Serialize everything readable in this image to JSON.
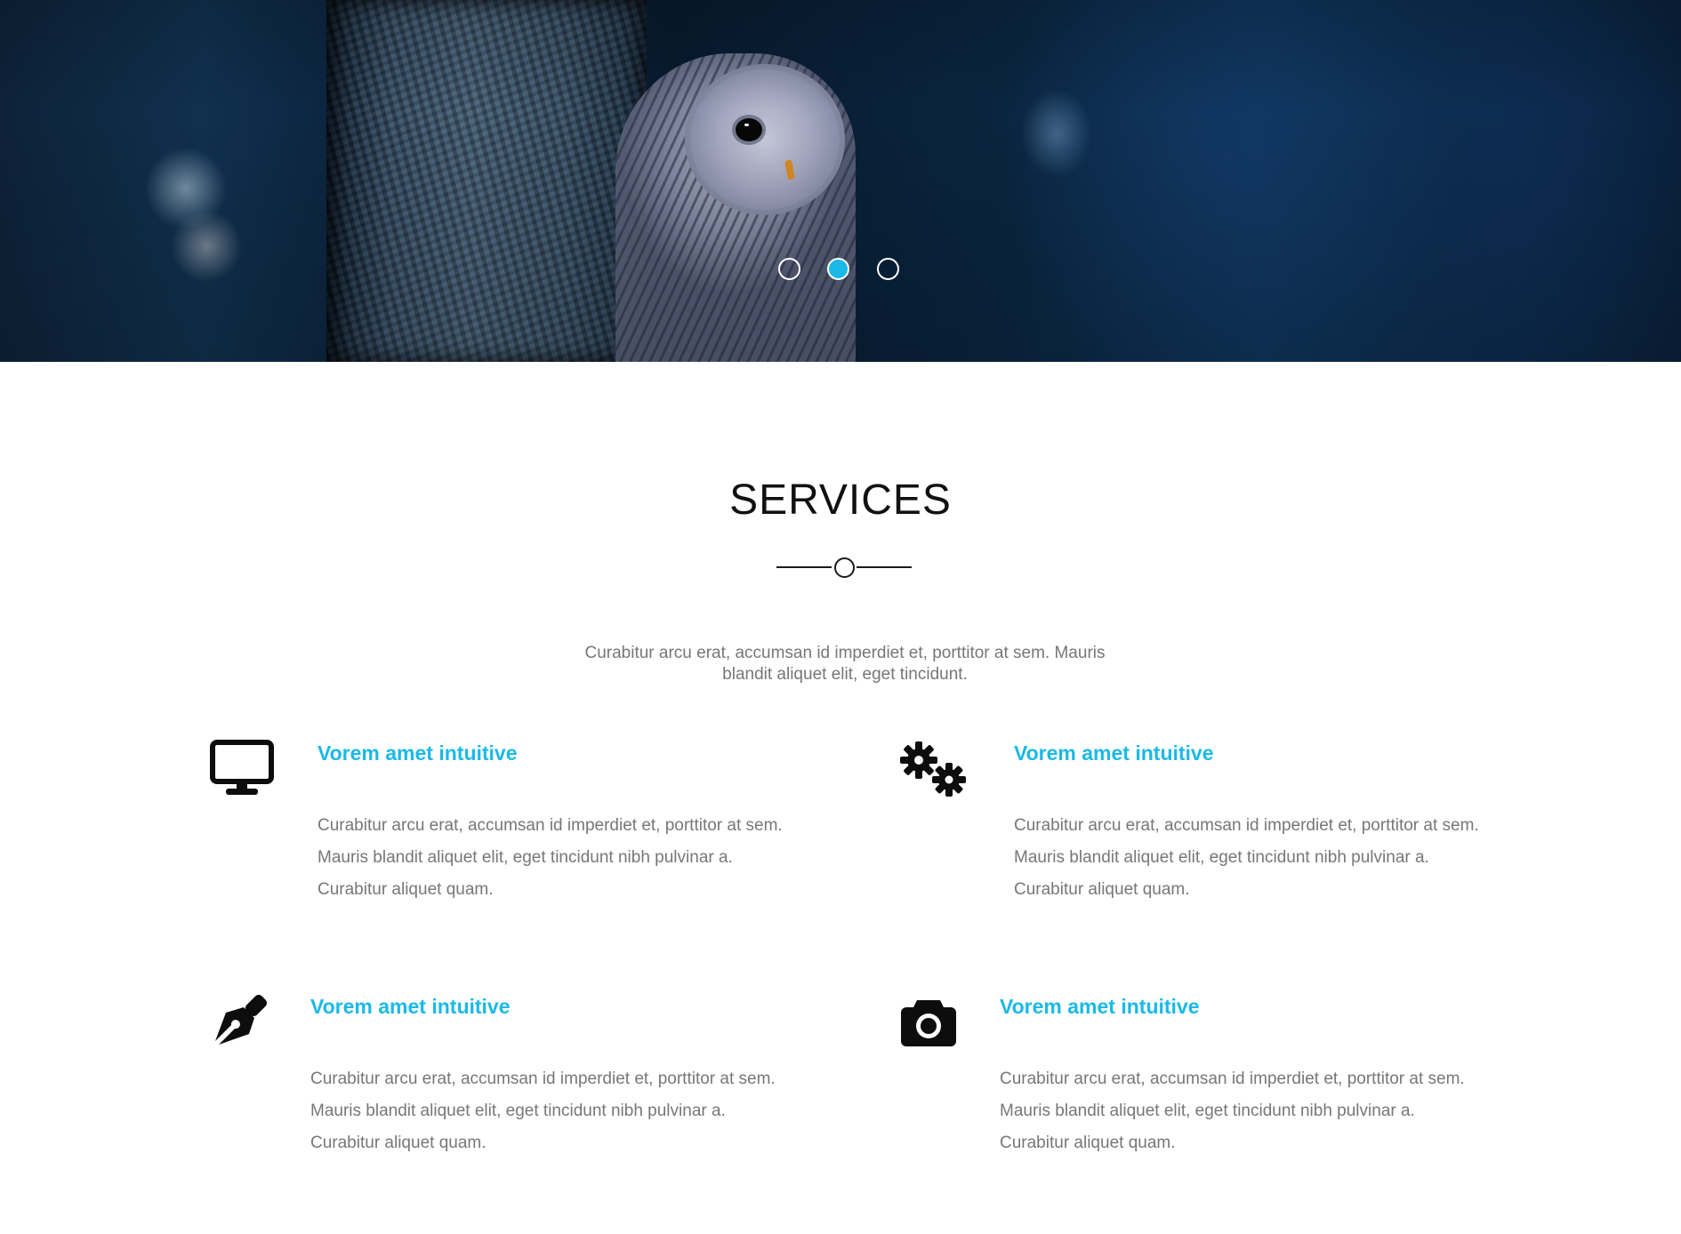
{
  "hero": {
    "slides": [
      {
        "label": "slide-1",
        "active": false
      },
      {
        "label": "slide-2",
        "active": true
      },
      {
        "label": "slide-3",
        "active": false
      }
    ],
    "accent_color": "#1ab9e8"
  },
  "services": {
    "title": "SERVICES",
    "intro": "Curabitur arcu erat, accumsan id imperdiet et, porttitor at sem. Mauris blandit aliquet elit, eget tincidunt.",
    "items": [
      {
        "icon": "desktop-icon",
        "title": "Vorem amet intuitive",
        "text": "Curabitur arcu erat, accumsan id imperdiet et, porttitor at sem. Mauris blandit aliquet elit, eget tincidunt nibh pulvinar a. Curabitur aliquet quam."
      },
      {
        "icon": "gears-icon",
        "title": "Vorem amet intuitive",
        "text": "Curabitur arcu erat, accumsan id imperdiet et, porttitor at sem. Mauris blandit aliquet elit, eget tincidunt nibh pulvinar a. Curabitur aliquet quam."
      },
      {
        "icon": "pen-nib-icon",
        "title": "Vorem amet intuitive",
        "text": "Curabitur arcu erat, accumsan id imperdiet et, porttitor at sem. Mauris blandit aliquet elit, eget tincidunt nibh pulvinar a. Curabitur aliquet quam."
      },
      {
        "icon": "camera-icon",
        "title": "Vorem amet intuitive",
        "text": "Curabitur arcu erat, accumsan id imperdiet et, porttitor at sem. Mauris blandit aliquet elit, eget tincidunt nibh pulvinar a. Curabitur aliquet quam."
      }
    ]
  }
}
